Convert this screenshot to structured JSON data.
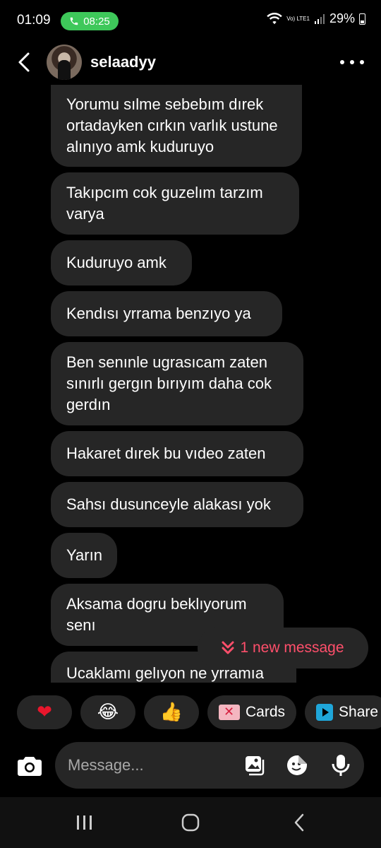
{
  "status_bar": {
    "time": "01:09",
    "call_time": "08:25",
    "network": "Vo) LTE1",
    "battery": "29%"
  },
  "header": {
    "username": "selaadyy"
  },
  "messages": [
    {
      "text": "Yorumu sılme sebebım dırek ortadayken cırkın varlık ustune alınıyo amk kuduruyo"
    },
    {
      "text": "Takıpcım cok guzelım tarzım varya"
    },
    {
      "text": "Kuduruyo amk"
    },
    {
      "text": "Kendısı yrrama benzıyo ya"
    },
    {
      "text": "Ben senınle ugrasıcam zaten sınırlı gergın bırıyım daha cok gerdın"
    },
    {
      "text": "Hakaret dırek bu vıdeo zaten"
    },
    {
      "text": "Sahsı dusunceyle alakası yok"
    },
    {
      "text": "Yarın"
    },
    {
      "text": "Aksama dogru beklıyorum senı"
    },
    {
      "text": "Ucaklamı gelıyon ne yrramıa"
    }
  ],
  "new_message_pill": {
    "label": "1 new message"
  },
  "quick_actions": {
    "heart": "❤",
    "laugh": "😂",
    "thumbs": "👍",
    "cards_label": "Cards",
    "share_label": "Share"
  },
  "composer": {
    "placeholder": "Message..."
  },
  "colors": {
    "background": "#000000",
    "bubble": "#262626",
    "accent_red": "#ff4f6b",
    "call_green": "#3ec85a"
  }
}
